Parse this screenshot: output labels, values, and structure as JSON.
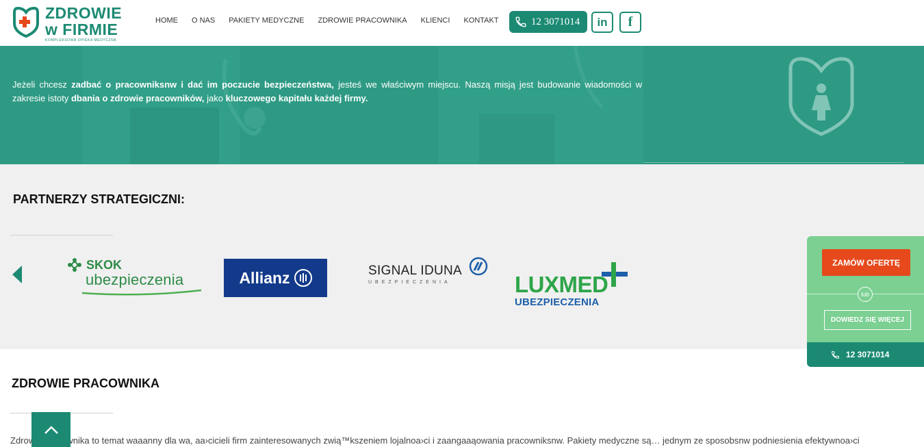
{
  "header": {
    "logo_line1": "ZDROWIE",
    "logo_line2": "w FIRMIE",
    "logo_tagline": "KOMPLEKSOWA OPIEKA MEDYCZNA",
    "nav": [
      "HOME",
      "O NAS",
      "PAKIETY MEDYCZNE",
      "ZDROWIE PRACOWNIKA",
      "KLIENCI",
      "KONTAKT"
    ],
    "phone": "12 3071014",
    "linkedin_label": "in",
    "facebook_label": "f"
  },
  "hero": {
    "t1": "Jeżeli chcesz ",
    "b1": "zadbać o pracowniksnw i dać im poczucie bezpieczeństwa,",
    "t2": " jesteś we właściwym miejscu. Naszą misją jest budowanie wiadomości w zakresie istoty ",
    "b2": "dbania o zdrowie pracowników,",
    "t3": " jako ",
    "b3": "kluczowego kapitału każdej firmy."
  },
  "partners": {
    "title": "PARTNERZY STRATEGICZNI:",
    "skok_top": "SKOK",
    "skok_bottom": "ubezpieczenia",
    "allianz": "Allianz",
    "signal_name": "SIGNAL IDUNA",
    "signal_sub": "UBEZPIECZENIA",
    "luxmed_name": "LUXMED",
    "luxmed_sub": "UBEZPIECZENIA"
  },
  "section": {
    "title": "ZDROWIE PRACOWNIKA",
    "body": "Zdrowie pracownika to temat waaanny dla wa, aa›cicieli firm zainteresowanych zwią™kszeniem lojalnoa›ci i zaangaaąowania pracowniksnw. Pakiety medyczne są… jednym ze sposobsnw podniesienia efektywnoa›ci"
  },
  "side": {
    "order_label": "ZAMÓW OFERTĘ",
    "or_label": "lub",
    "more_label": "DOWIEDZ SIĘ WIĘCEJ",
    "phone": "12 3071014"
  },
  "colors": {
    "brand": "#1c8a73",
    "hero_bg": "#2e9a84",
    "side_bg": "#7bd092",
    "cta": "#e6491c"
  }
}
